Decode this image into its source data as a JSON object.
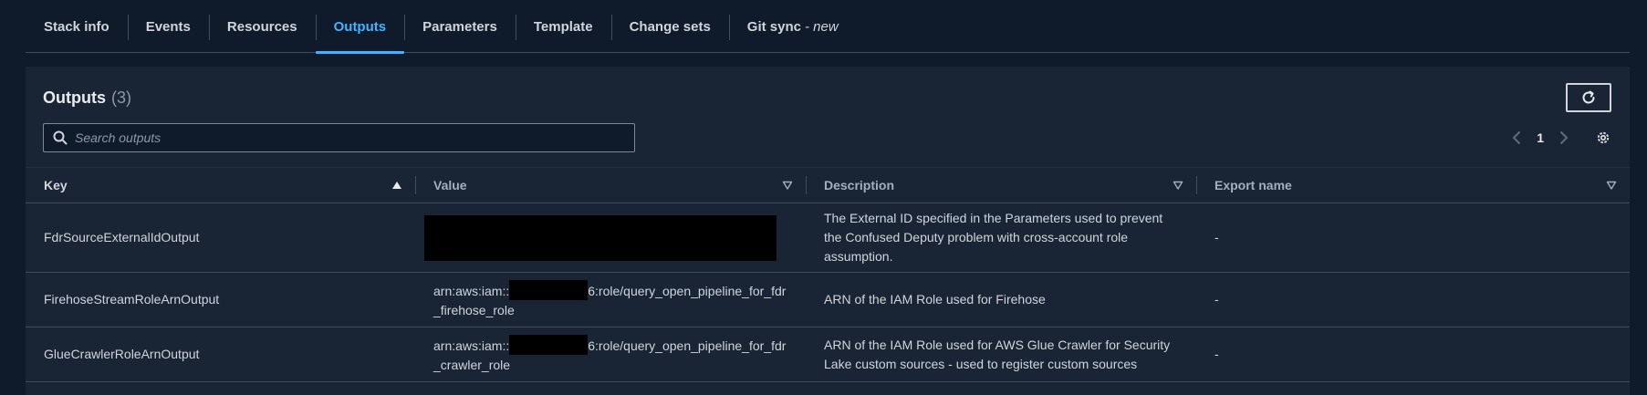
{
  "tabs": [
    {
      "label": "Stack info"
    },
    {
      "label": "Events"
    },
    {
      "label": "Resources"
    },
    {
      "label": "Outputs",
      "active": true
    },
    {
      "label": "Parameters"
    },
    {
      "label": "Template"
    },
    {
      "label": "Change sets"
    },
    {
      "label": "Git sync",
      "suffix": "- new"
    }
  ],
  "outputs": {
    "title": "Outputs",
    "count": "(3)",
    "search_placeholder": "Search outputs",
    "page": "1"
  },
  "table": {
    "columns": [
      "Key",
      "Value",
      "Description",
      "Export name"
    ],
    "rows": [
      {
        "key": "FdrSourceExternalIdOutput",
        "value_redacted": true,
        "description": "The External ID specified in the Parameters used to prevent the Confused Deputy problem with cross-account role assumption.",
        "export": "-"
      },
      {
        "key": "FirehoseStreamRoleArnOutput",
        "value_prefix": "arn:aws:iam::",
        "value_suffix": "6:role/query_open_pipeline_for_fdr_firehose_role",
        "description": "ARN of the IAM Role used for Firehose",
        "export": "-"
      },
      {
        "key": "GlueCrawlerRoleArnOutput",
        "value_prefix": "arn:aws:iam::",
        "value_suffix": "6:role/query_open_pipeline_for_fdr_crawler_role",
        "description": "ARN of the IAM Role used for AWS Glue Crawler for Security Lake custom sources - used to register custom sources",
        "export": "-"
      }
    ]
  },
  "colors": {
    "background": "#0f1b2a",
    "panel": "#192534",
    "accent": "#42b4ff",
    "border": "#414d5c"
  },
  "icons": [
    "search-icon",
    "refresh-icon",
    "chevron-left-icon",
    "chevron-right-icon",
    "gear-icon",
    "sort-ascending-icon",
    "sort-descending-icon"
  ]
}
